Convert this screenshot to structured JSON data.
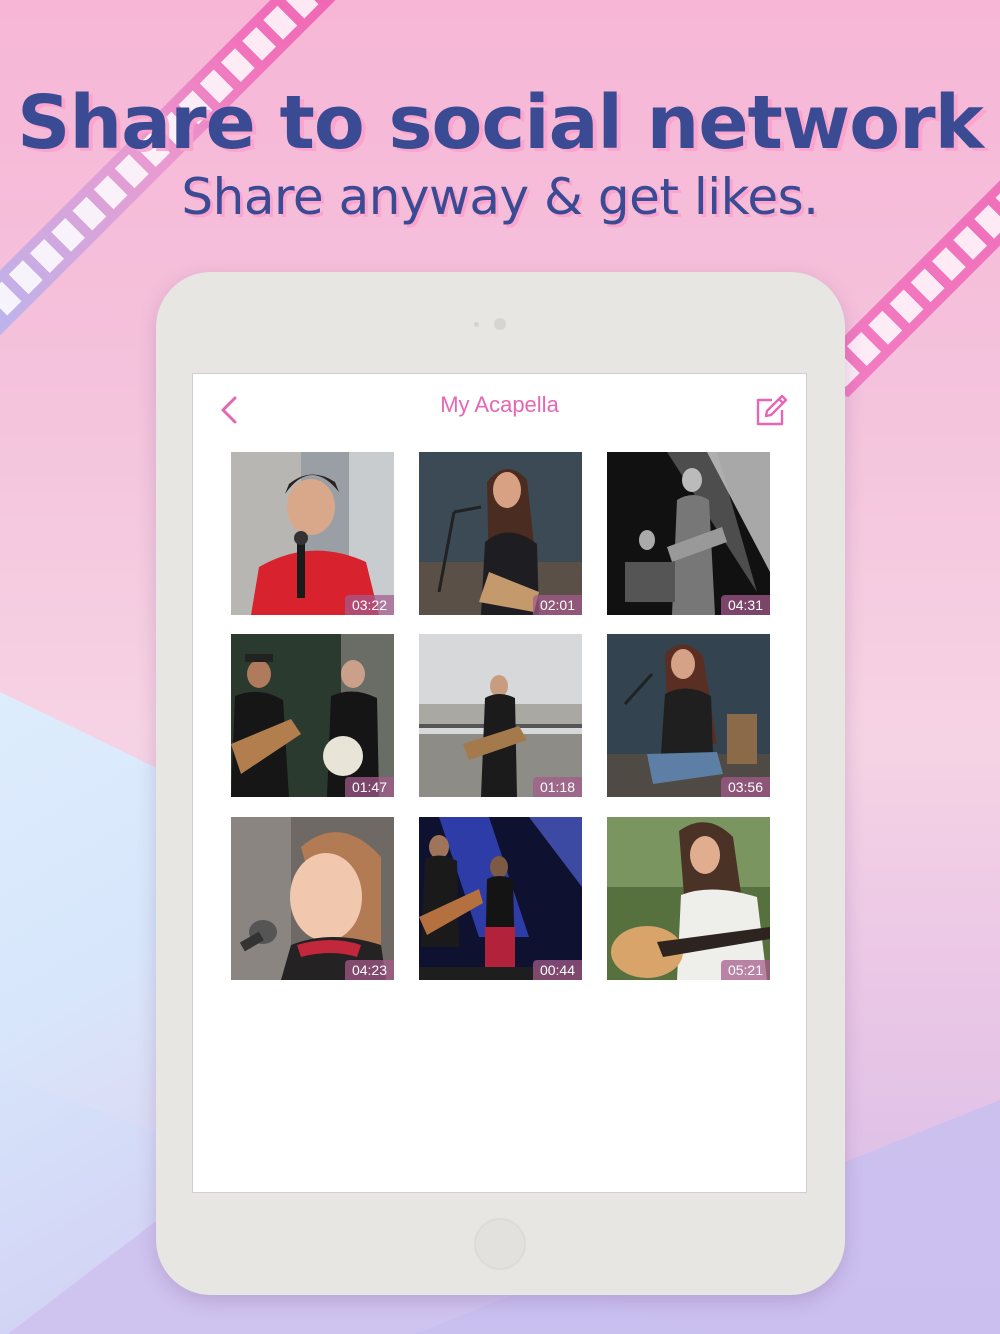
{
  "headline": {
    "title": "Share to social network",
    "subtitle": "Share anyway & get likes."
  },
  "app": {
    "title": "My Acapella",
    "back_icon": "chevron-left-icon",
    "edit_icon": "edit-pencil-icon",
    "accent_color": "#e566b5"
  },
  "videos": [
    {
      "duration": "03:22",
      "subject": "boy with microphone in red hoodie"
    },
    {
      "duration": "02:01",
      "subject": "woman singing with guitar"
    },
    {
      "duration": "04:31",
      "subject": "black and white band on stage"
    },
    {
      "duration": "01:47",
      "subject": "two men with guitar and banjo"
    },
    {
      "duration": "01:18",
      "subject": "street musician with guitar"
    },
    {
      "duration": "03:56",
      "subject": "woman singing with guitar"
    },
    {
      "duration": "04:23",
      "subject": "girl singing into microphone"
    },
    {
      "duration": "00:44",
      "subject": "band on blue-lit stage"
    },
    {
      "duration": "05:21",
      "subject": "girl playing acoustic guitar outdoors"
    }
  ]
}
